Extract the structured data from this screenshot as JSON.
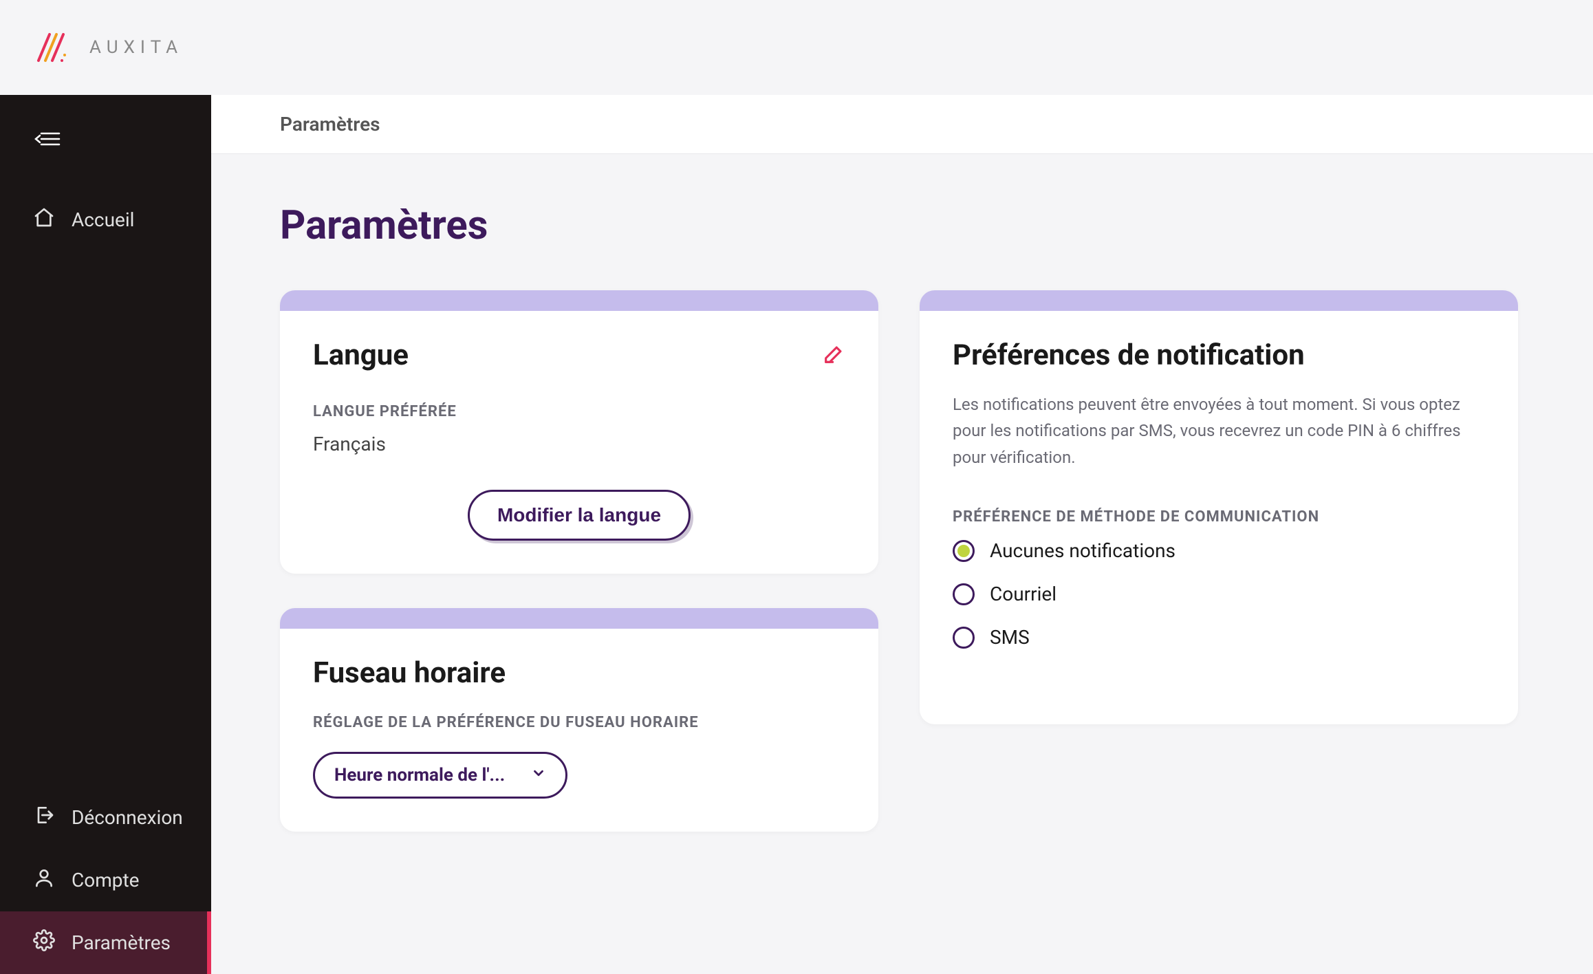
{
  "header": {
    "brand": "AUXITA"
  },
  "sidebar": {
    "items": {
      "home": "Accueil",
      "logout": "Déconnexion",
      "account": "Compte",
      "settings": "Paramètres"
    }
  },
  "breadcrumb": "Paramètres",
  "page_title": "Paramètres",
  "language_card": {
    "title": "Langue",
    "label": "LANGUE PRÉFÉRÉE",
    "value": "Français",
    "button": "Modifier la langue"
  },
  "timezone_card": {
    "title": "Fuseau horaire",
    "label": "RÉGLAGE DE LA PRÉFÉRENCE DU FUSEAU HORAIRE",
    "selected": "Heure normale de l'..."
  },
  "notifications_card": {
    "title": "Préférences de notification",
    "description": "Les notifications peuvent être envoyées à tout moment. Si vous optez pour les notifications par SMS, vous recevrez un code PIN à 6 chiffres pour vérification.",
    "label": "PRÉFÉRENCE DE MÉTHODE DE COMMUNICATION",
    "options": {
      "none": "Aucunes notifications",
      "email": "Courriel",
      "sms": "SMS"
    }
  }
}
